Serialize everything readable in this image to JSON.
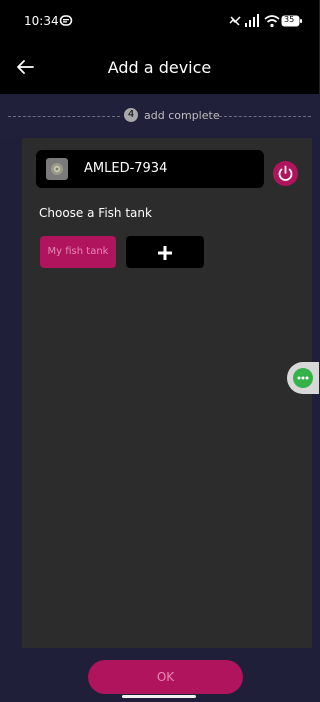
{
  "status": {
    "time": "10:34",
    "icons": [
      "message-icon",
      "mute-icon",
      "signal-icon",
      "wifi-icon",
      "battery-icon"
    ],
    "battery_level": "35"
  },
  "header": {
    "title": "Add a device",
    "back_icon": "arrow-left-icon"
  },
  "progress": {
    "step_number": "4",
    "step_label": "add complete"
  },
  "device": {
    "name": "AMLED-7934",
    "icons": [
      "device-thumbnail-icon",
      "power-icon"
    ]
  },
  "tank_section": {
    "heading": "Choose a Fish tank",
    "tanks": [
      {
        "label": "My fish tank"
      }
    ],
    "add_icon": "plus-icon"
  },
  "floating": {
    "icon": "more-horizontal-icon"
  },
  "footer": {
    "ok_label": "OK"
  },
  "colors": {
    "accent": "#b0145c",
    "background": "#1f1f3a",
    "panel": "#2c2c2c",
    "floating_green": "#35b24a"
  }
}
